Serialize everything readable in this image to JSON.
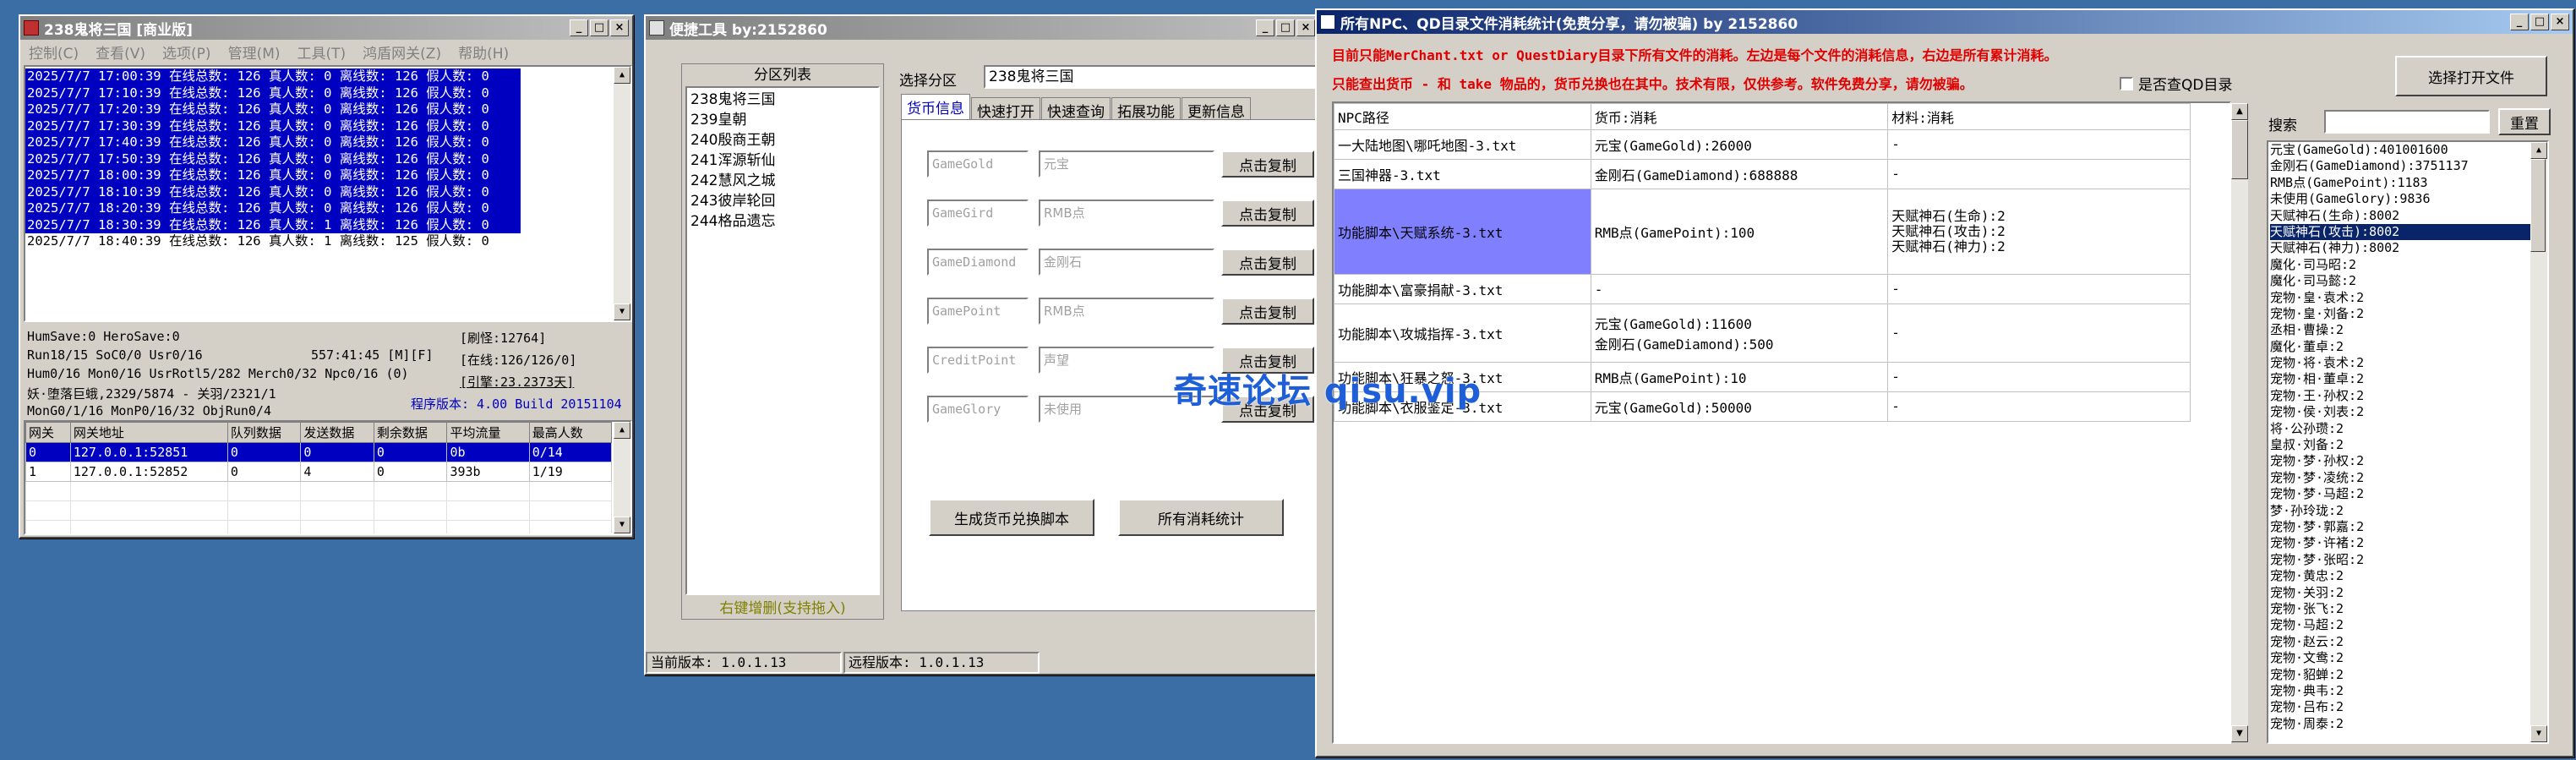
{
  "win1": {
    "title": "238鬼将三国 [商业版]",
    "menu": [
      "控制(C)",
      "查看(V)",
      "选项(P)",
      "管理(M)",
      "工具(T)",
      "鸿盾网关(Z)",
      "帮助(H)"
    ],
    "log": [
      "2025/7/7 17:00:39 在线总数: 126 真人数: 0 离线数: 126 假人数: 0",
      "2025/7/7 17:10:39 在线总数: 126 真人数: 0 离线数: 126 假人数: 0",
      "2025/7/7 17:20:39 在线总数: 126 真人数: 0 离线数: 126 假人数: 0",
      "2025/7/7 17:30:39 在线总数: 126 真人数: 0 离线数: 126 假人数: 0",
      "2025/7/7 17:40:39 在线总数: 126 真人数: 0 离线数: 126 假人数: 0",
      "2025/7/7 17:50:39 在线总数: 126 真人数: 0 离线数: 126 假人数: 0",
      "2025/7/7 18:00:39 在线总数: 126 真人数: 0 离线数: 126 假人数: 0",
      "2025/7/7 18:10:39 在线总数: 126 真人数: 0 离线数: 126 假人数: 0",
      "2025/7/7 18:20:39 在线总数: 126 真人数: 0 离线数: 126 假人数: 0",
      "2025/7/7 18:30:39 在线总数: 126 真人数: 1 离线数: 126 假人数: 0",
      "2025/7/7 18:40:39 在线总数: 126 真人数: 1 离线数: 125 假人数: 0"
    ],
    "stats": {
      "line1": "HumSave:0 HeroSave:0",
      "line2": "Run18/15 SoC0/0 Usr0/16",
      "line2b": "557:41:45 [M][F]",
      "line3": "Hum0/16 Mon0/16 UsrRotl5/282 Merch0/32 Npc0/16 (0)",
      "line4": "妖·堕落巨蛾,2329/5874 - 关羽/2321/1",
      "line5": "MonG0/1/16 MonP0/16/32 ObjRun0/4",
      "refresh": "[刷怪:12764]",
      "online": "[在线:126/126/0]",
      "engine": "[引擎:23.2373天]",
      "version": "程序版本: 4.00 Build 20151104"
    },
    "gw_headers": [
      "网关",
      "网关地址",
      "队列数据",
      "发送数据",
      "剩余数据",
      "平均流量",
      "最高人数"
    ],
    "gw_rows": [
      [
        "0",
        "127.0.0.1:52851",
        "0",
        "0",
        "0",
        "0b",
        "0/14"
      ],
      [
        "1",
        "127.0.0.1:52852",
        "0",
        "4",
        "0",
        "393b",
        "1/19"
      ]
    ]
  },
  "win2": {
    "title": "便捷工具  by:2152860",
    "zone_list_title": "分区列表",
    "zones": [
      "238鬼将三国",
      "239皇朝",
      "240殷商王朝",
      "241浑源斩仙",
      "242慧风之城",
      "243彼岸轮回",
      "244格品遗忘"
    ],
    "zone_footer": "右键增删(支持拖入)",
    "select_label": "选择分区",
    "select_value": "238鬼将三国",
    "tabs": [
      "货币信息",
      "快速打开",
      "快速查询",
      "拓展功能",
      "更新信息"
    ],
    "fields": [
      {
        "code": "GameGold",
        "name": "元宝",
        "btn": "点击复制"
      },
      {
        "code": "GameGird",
        "name": "RMB点",
        "btn": "点击复制"
      },
      {
        "code": "GameDiamond",
        "name": "金刚石",
        "btn": "点击复制"
      },
      {
        "code": "GamePoint",
        "name": "RMB点",
        "btn": "点击复制"
      },
      {
        "code": "CreditPoint",
        "name": "声望",
        "btn": "点击复制"
      },
      {
        "code": "GameGlory",
        "name": "未使用",
        "btn": "点击复制"
      }
    ],
    "btn_gen": "生成货币兑换脚本",
    "btn_stats": "所有消耗统计",
    "status_local": "当前版本: 1.0.1.13",
    "status_remote": "远程版本: 1.0.1.13"
  },
  "win3": {
    "title": "所有NPC、QD目录文件消耗统计(免费分享，请勿被骗)    by 2152860",
    "note1": "目前只能MerChant.txt or QuestDiary目录下所有文件的消耗。左边是每个文件的消耗信息，右边是所有累计消耗。",
    "note2": "只能查出货币 - 和 take 物品的，货币兑换也在其中。技术有限，仅供参考。软件免费分享，请勿被骗。",
    "checkbox_label": "是否查QD目录",
    "btn_open": "选择打开文件",
    "search_label": "搜索",
    "btn_reset": "重置",
    "headers": [
      "NPC路径",
      "货币:消耗",
      "材料:消耗"
    ],
    "rows": [
      {
        "path": "一大陆地图\\哪吒地图-3.txt",
        "cur": [
          "元宝(GameGold):26000"
        ],
        "mat": [
          "-"
        ]
      },
      {
        "path": "三国神器-3.txt",
        "cur": [
          "金刚石(GameDiamond):688888"
        ],
        "mat": [
          "-"
        ]
      },
      {
        "path": "功能脚本\\天赋系统-3.txt",
        "cur": [
          "RMB点(GamePoint):100"
        ],
        "mat": [
          "天赋神石(生命):2",
          "天赋神石(攻击):2",
          "天赋神石(神力):2"
        ]
      },
      {
        "path": "功能脚本\\富豪捐献-3.txt",
        "cur": [
          "-"
        ],
        "mat": [
          "-"
        ]
      },
      {
        "path": "功能脚本\\攻城指挥-3.txt",
        "cur": [
          "元宝(GameGold):11600",
          "金刚石(GameDiamond):500"
        ],
        "mat": [
          "-"
        ]
      },
      {
        "path": "功能脚本\\狂暴之怒-3.txt",
        "cur": [
          "RMB点(GamePoint):10"
        ],
        "mat": [
          "-"
        ]
      },
      {
        "path": "功能脚本\\衣服鉴定-3.txt",
        "cur": [
          "元宝(GameGold):50000"
        ],
        "mat": [
          "-"
        ]
      }
    ],
    "totals": [
      "元宝(GameGold):401001600",
      "金刚石(GameDiamond):3751137",
      "RMB点(GamePoint):1183",
      "未使用(GameGlory):9836",
      "天赋神石(生命):8002",
      "天赋神石(攻击):8002",
      "天赋神石(神力):8002",
      "魔化·司马昭:2",
      "魔化·司马懿:2",
      "宠物·皇·袁术:2",
      "宠物·皇·刘备:2",
      "丞相·曹操:2",
      "魔化·董卓:2",
      "宠物·将·袁术:2",
      "宠物·相·董卓:2",
      "宠物·王·孙权:2",
      "宠物·侯·刘表:2",
      "将·公孙瓒:2",
      "皇叔·刘备:2",
      "宠物·梦·孙权:2",
      "宠物·梦·凌统:2",
      "宠物·梦·马超:2",
      "梦·孙玲珑:2",
      "宠物·梦·郭嘉:2",
      "宠物·梦·许褚:2",
      "宠物·梦·张昭:2",
      "宠物·黄忠:2",
      "宠物·关羽:2",
      "宠物·张飞:2",
      "宠物·马超:2",
      "宠物·赵云:2",
      "宠物·文鸯:2",
      "宠物·貂蝉:2",
      "宠物·典韦:2",
      "宠物·吕布:2",
      "宠物·周泰:2"
    ],
    "selected_total_index": 5
  },
  "watermark": "奇速论坛 qisu.vip"
}
